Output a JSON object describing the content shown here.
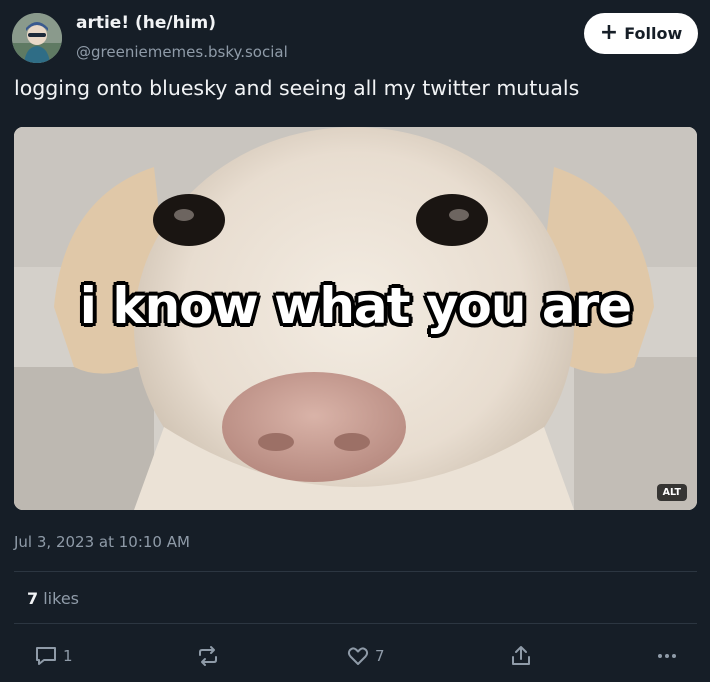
{
  "author": {
    "display_name": "artie! (he/him)",
    "handle": "@greeniememes.bsky.social",
    "avatar_icon": "avatar-icon"
  },
  "follow_button": {
    "label": "Follow",
    "icon": "plus-icon"
  },
  "post": {
    "text": "logging onto bluesky and seeing all my twitter mutuals",
    "image": {
      "caption": "i know what you are",
      "alt_badge": "ALT"
    },
    "timestamp": "Jul 3, 2023 at 10:10 AM"
  },
  "stats": {
    "likes_count": "7",
    "likes_label": "likes"
  },
  "actions": {
    "reply_count": "1",
    "repost_count": "",
    "like_count": "7"
  },
  "colors": {
    "background": "#161e27",
    "text_primary": "#f1f3f5",
    "text_secondary": "#8f9ba8",
    "divider": "#2c3641",
    "button_bg": "#ffffff"
  }
}
